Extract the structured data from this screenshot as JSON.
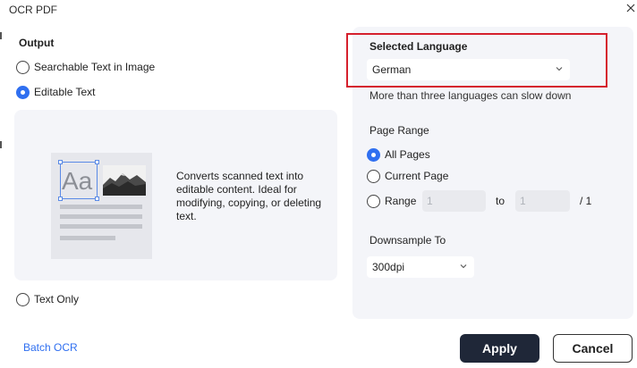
{
  "window": {
    "title": "OCR PDF",
    "close_icon": "close-icon"
  },
  "output": {
    "title": "Output",
    "options": [
      {
        "label": "Searchable Text in Image",
        "selected": false
      },
      {
        "label": "Editable Text",
        "selected": true
      },
      {
        "label": "Text Only",
        "selected": false
      }
    ],
    "preview_icons": [
      "text-aa-icon",
      "landscape-photo-icon",
      "document-icon"
    ],
    "description": "Converts scanned text into editable content. Ideal for modifying, copying, or deleting text."
  },
  "language": {
    "title": "Selected Language",
    "selected": "German",
    "hint": "More than three languages can slow down"
  },
  "page_range": {
    "title": "Page Range",
    "options": [
      {
        "label": "All Pages",
        "selected": true
      },
      {
        "label": "Current Page",
        "selected": false
      },
      {
        "label": "Range",
        "selected": false
      }
    ],
    "from_value": "1",
    "to_label": "to",
    "to_value": "1",
    "total": "/ 1"
  },
  "downsample": {
    "title": "Downsample To",
    "selected": "300dpi"
  },
  "footer": {
    "batch_label": "Batch OCR",
    "apply_label": "Apply",
    "cancel_label": "Cancel"
  },
  "colors": {
    "accent": "#2f6ff0",
    "highlight": "#d5202d",
    "apply_bg": "#1f2738",
    "panel": "#f4f5f9"
  }
}
